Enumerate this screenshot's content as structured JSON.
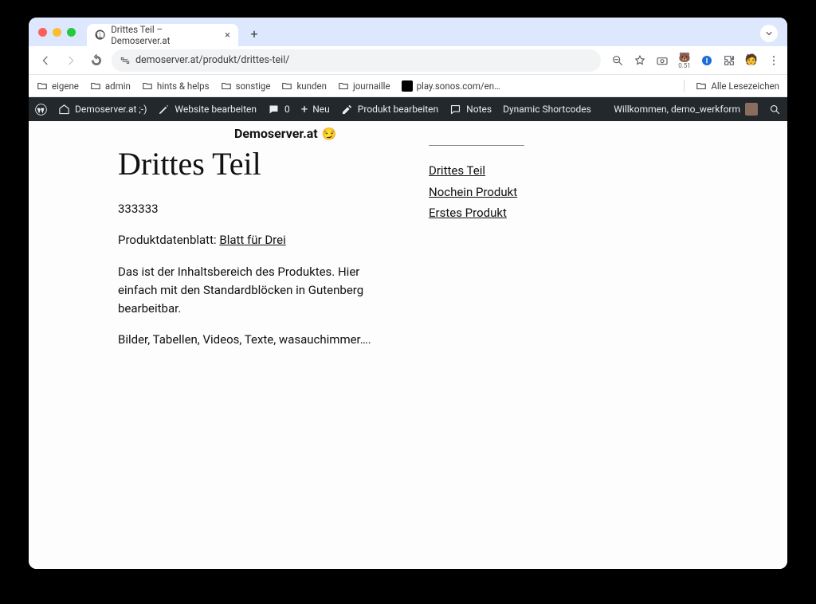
{
  "browser": {
    "tab_title": "Drittes Teil – Demoserver.at",
    "url": "demoserver.at/produkt/drittes-teil/"
  },
  "bookmarks": {
    "items": [
      "eigene",
      "admin",
      "hints & helps",
      "sonstige",
      "kunden",
      "journaille",
      "play.sonos.com/en…"
    ],
    "all": "Alle Lesezeichen"
  },
  "wpbar": {
    "site": "Demoserver.at ;-)",
    "edit_site": "Website bearbeiten",
    "comments": "0",
    "neu": "Neu",
    "edit_product": "Produkt bearbeiten",
    "notes": "Notes",
    "dynamic": "Dynamic Shortcodes",
    "welcome": "Willkommen, demo_werkform"
  },
  "site": {
    "title": "Demoserver.at"
  },
  "post": {
    "title": "Drittes Teil",
    "number": "333333",
    "datasheet_label": "Produktdatenblatt: ",
    "datasheet_link": "Blatt für Drei",
    "para1": "Das ist der Inhaltsbereich des Produktes. Hier einfach mit den Standardblöcken in Gutenberg bearbeitbar.",
    "para2": "Bilder, Tabellen, Videos, Texte, wasauchimmer…."
  },
  "sidebar_nav": {
    "items": [
      "Drittes Teil",
      "Nochein Produkt",
      "Erstes Produkt"
    ]
  },
  "ext": {
    "zoom_badge": "0.51"
  }
}
